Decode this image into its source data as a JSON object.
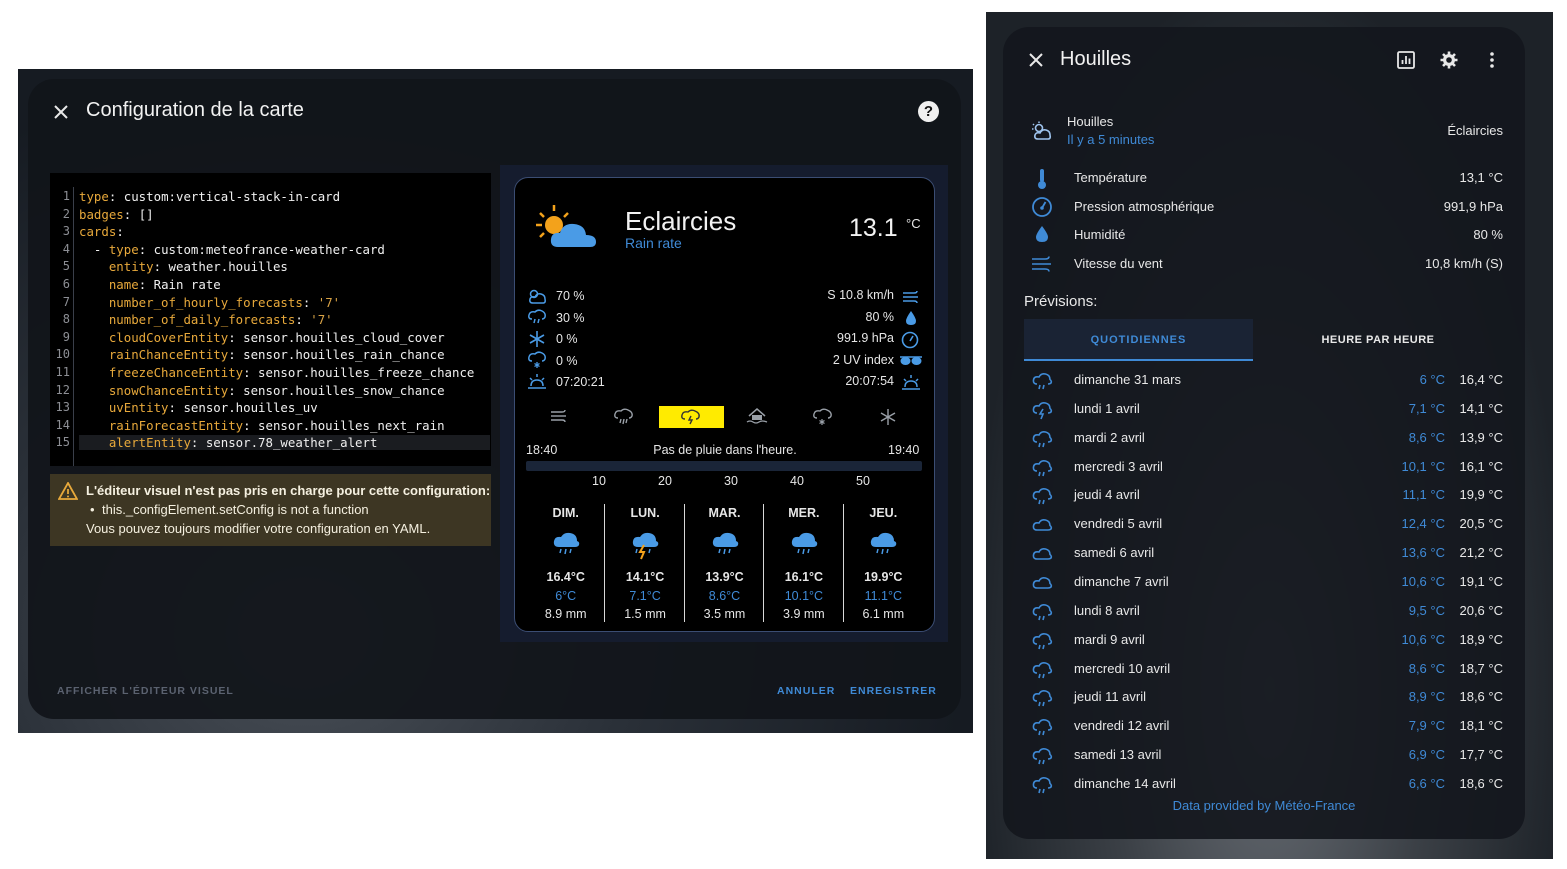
{
  "left": {
    "title": "Configuration de la carte",
    "editor": {
      "line_numbers": [
        "1",
        "2",
        "3",
        "4",
        "5",
        "6",
        "7",
        "8",
        "9",
        "10",
        "11",
        "12",
        "13",
        "14",
        "15"
      ],
      "lines": [
        {
          "key": "type",
          "sep": ": ",
          "val": "custom:vertical-stack-in-card",
          "indent": ""
        },
        {
          "key": "badges",
          "sep": ": ",
          "val": "[]",
          "indent": ""
        },
        {
          "key": "cards",
          "sep": ":",
          "val": "",
          "indent": ""
        },
        {
          "key": "type",
          "sep": ": ",
          "val": "custom:meteofrance-weather-card",
          "indent": "  - "
        },
        {
          "key": "entity",
          "sep": ": ",
          "val": "weather.houilles",
          "indent": "    "
        },
        {
          "key": "name",
          "sep": ": ",
          "val": "Rain rate",
          "indent": "    "
        },
        {
          "key": "number_of_hourly_forecasts",
          "sep": ": ",
          "val": "'7'",
          "indent": "    "
        },
        {
          "key": "number_of_daily_forecasts",
          "sep": ": ",
          "val": "'7'",
          "indent": "    "
        },
        {
          "key": "cloudCoverEntity",
          "sep": ": ",
          "val": "sensor.houilles_cloud_cover",
          "indent": "    "
        },
        {
          "key": "rainChanceEntity",
          "sep": ": ",
          "val": "sensor.houilles_rain_chance",
          "indent": "    "
        },
        {
          "key": "freezeChanceEntity",
          "sep": ": ",
          "val": "sensor.houilles_freeze_chance",
          "indent": "    "
        },
        {
          "key": "snowChanceEntity",
          "sep": ": ",
          "val": "sensor.houilles_snow_chance",
          "indent": "    "
        },
        {
          "key": "uvEntity",
          "sep": ": ",
          "val": "sensor.houilles_uv",
          "indent": "    "
        },
        {
          "key": "rainForecastEntity",
          "sep": ": ",
          "val": "sensor.houilles_next_rain",
          "indent": "    "
        },
        {
          "key": "alertEntity",
          "sep": ": ",
          "val": "sensor.78_weather_alert",
          "indent": "    "
        }
      ]
    },
    "warning": {
      "title": "L'éditeur visuel n'est pas pris en charge pour cette configuration:",
      "item": "this._configElement.setConfig is not a function",
      "note": "Vous pouvez toujours modifier votre configuration en YAML."
    },
    "buttons": {
      "visual": "AFFICHER L'ÉDITEUR VISUEL",
      "cancel": "ANNULER",
      "save": "ENREGISTRER"
    },
    "card": {
      "condition": "Eclaircies",
      "name": "Rain rate",
      "temp": "13.1",
      "unit": "°C",
      "left_attrs": [
        "70 %",
        "30 %",
        "0 %",
        "0 %",
        "07:20:21"
      ],
      "right_attrs": [
        "S 10.8 km/h",
        "80 %",
        "991.9 hPa",
        "2 UV index",
        "20:07:54"
      ],
      "rain_start": "18:40",
      "rain_text": "Pas de pluie dans l'heure.",
      "rain_end": "19:40",
      "rain_ticks": [
        "10",
        "20",
        "30",
        "40",
        "50"
      ],
      "days": [
        {
          "name": "DIM.",
          "high": "16.4°C",
          "low": "6°C",
          "rain": "8.9 mm"
        },
        {
          "name": "LUN.",
          "high": "14.1°C",
          "low": "7.1°C",
          "rain": "1.5 mm"
        },
        {
          "name": "MAR.",
          "high": "13.9°C",
          "low": "8.6°C",
          "rain": "3.5 mm"
        },
        {
          "name": "MER.",
          "high": "16.1°C",
          "low": "10.1°C",
          "rain": "3.9 mm"
        },
        {
          "name": "JEU.",
          "high": "19.9°C",
          "low": "11.1°C",
          "rain": "6.1 mm"
        }
      ],
      "highlight_color": "#ffeb00"
    }
  },
  "right": {
    "title": "Houilles",
    "entity_name": "Houilles",
    "updated": "Il y a 5 minutes",
    "state": "Éclaircies",
    "attributes": [
      {
        "label": "Température",
        "value": "13,1 °C",
        "icon": "thermometer-icon"
      },
      {
        "label": "Pression atmosphérique",
        "value": "991,9 hPa",
        "icon": "gauge-icon"
      },
      {
        "label": "Humidité",
        "value": "80 %",
        "icon": "water-percent-icon"
      },
      {
        "label": "Vitesse du vent",
        "value": "10,8 km/h (S)",
        "icon": "wind-icon"
      }
    ],
    "forecast_title": "Prévisions:",
    "tabs": {
      "daily": "QUOTIDIENNES",
      "hourly": "HEURE PAR HEURE"
    },
    "forecast": [
      {
        "day": "dimanche 31 mars",
        "low": "6 °C",
        "high": "16,4 °C",
        "icon": "rain-icon"
      },
      {
        "day": "lundi 1 avril",
        "low": "7,1 °C",
        "high": "14,1 °C",
        "icon": "lightning-rain-icon"
      },
      {
        "day": "mardi 2 avril",
        "low": "8,6 °C",
        "high": "13,9 °C",
        "icon": "rain-icon"
      },
      {
        "day": "mercredi 3 avril",
        "low": "10,1 °C",
        "high": "16,1 °C",
        "icon": "rain-icon"
      },
      {
        "day": "jeudi 4 avril",
        "low": "11,1 °C",
        "high": "19,9 °C",
        "icon": "rain-icon"
      },
      {
        "day": "vendredi 5 avril",
        "low": "12,4 °C",
        "high": "20,5 °C",
        "icon": "cloud-icon"
      },
      {
        "day": "samedi 6 avril",
        "low": "13,6 °C",
        "high": "21,2 °C",
        "icon": "cloud-icon"
      },
      {
        "day": "dimanche 7 avril",
        "low": "10,6 °C",
        "high": "19,1 °C",
        "icon": "cloud-icon"
      },
      {
        "day": "lundi 8 avril",
        "low": "9,5 °C",
        "high": "20,6 °C",
        "icon": "rain-icon"
      },
      {
        "day": "mardi 9 avril",
        "low": "10,6 °C",
        "high": "18,9 °C",
        "icon": "rain-icon"
      },
      {
        "day": "mercredi 10 avril",
        "low": "8,6 °C",
        "high": "18,7 °C",
        "icon": "rain-icon"
      },
      {
        "day": "jeudi 11 avril",
        "low": "8,9 °C",
        "high": "18,6 °C",
        "icon": "rain-icon"
      },
      {
        "day": "vendredi 12 avril",
        "low": "7,9 °C",
        "high": "18,1 °C",
        "icon": "rain-icon"
      },
      {
        "day": "samedi 13 avril",
        "low": "6,9 °C",
        "high": "17,7 °C",
        "icon": "rain-icon"
      },
      {
        "day": "dimanche 14 avril",
        "low": "6,6 °C",
        "high": "18,6 °C",
        "icon": "rain-icon"
      }
    ],
    "credit": "Data provided by Météo-France",
    "accent": "#3f8ad6"
  }
}
